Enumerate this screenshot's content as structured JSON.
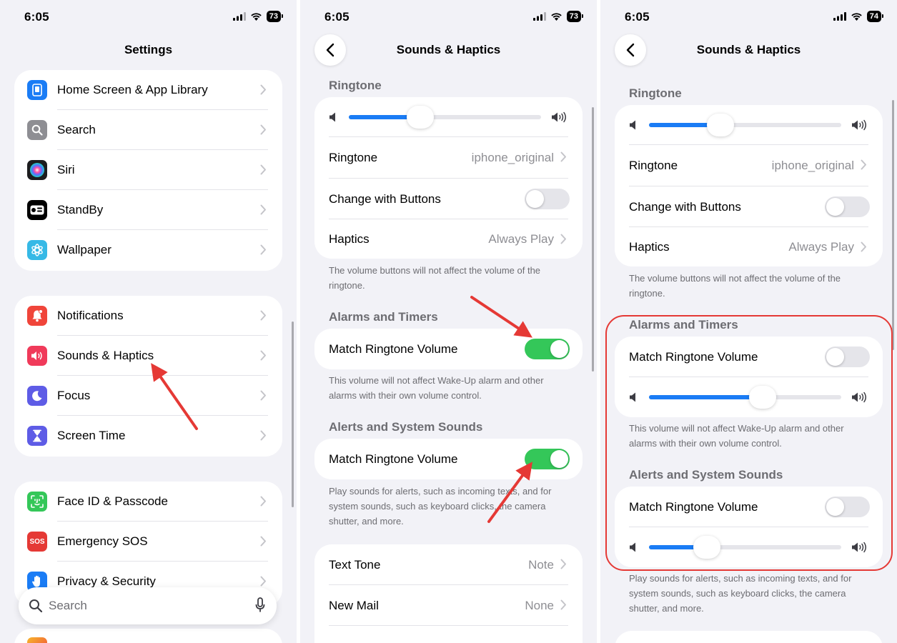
{
  "status": {
    "time_1": "6:05",
    "time_2": "6:05",
    "time_3": "6:05",
    "battery_1": "73",
    "battery_2": "73",
    "battery_3": "74"
  },
  "settings": {
    "title": "Settings",
    "group1": [
      {
        "label": "Home Screen & App Library",
        "icon": "home-screen-icon",
        "color": "#1a7cf5"
      },
      {
        "label": "Search",
        "icon": "search-icon",
        "color": "#8e8e93"
      },
      {
        "label": "Siri",
        "icon": "siri-icon",
        "color": "#1c1c1e"
      },
      {
        "label": "StandBy",
        "icon": "standby-icon",
        "color": "#000000"
      },
      {
        "label": "Wallpaper",
        "icon": "wallpaper-icon",
        "color": "#36b9e6"
      }
    ],
    "group2": [
      {
        "label": "Notifications",
        "icon": "bell-icon",
        "color": "#f0453a"
      },
      {
        "label": "Sounds & Haptics",
        "icon": "speaker-icon",
        "color": "#f03a5a"
      },
      {
        "label": "Focus",
        "icon": "moon-icon",
        "color": "#5e5ce6"
      },
      {
        "label": "Screen Time",
        "icon": "hourglass-icon",
        "color": "#5e5ce6"
      }
    ],
    "group3": [
      {
        "label": "Face ID & Passcode",
        "icon": "faceid-icon",
        "color": "#34c759"
      },
      {
        "label": "Emergency SOS",
        "icon": "sos-icon",
        "color": "#e53935",
        "badge": "SOS"
      },
      {
        "label": "Privacy & Security",
        "icon": "hand-icon",
        "color": "#1a7cf5"
      }
    ],
    "search_placeholder": "Search"
  },
  "sounds": {
    "title": "Sounds & Haptics",
    "ringtone_header": "Ringtone",
    "ringtone_label": "Ringtone",
    "ringtone_value": "iphone_original",
    "change_with_buttons": "Change with Buttons",
    "haptics_label": "Haptics",
    "haptics_value": "Always Play",
    "ringtone_footer": "The volume buttons will not affect the volume of the ringtone.",
    "alarms_header": "Alarms and Timers",
    "match_label": "Match Ringtone Volume",
    "alarms_footer": "This volume will not affect Wake-Up alarm and other alarms with their own volume control.",
    "alerts_header": "Alerts and System Sounds",
    "alerts_footer": "Play sounds for alerts, such as incoming texts, and for system sounds, such as keyboard clicks, the camera shutter, and more.",
    "text_tone_label": "Text Tone",
    "text_tone_value": "Note",
    "new_mail_label": "New Mail",
    "new_mail_value": "None"
  },
  "state": {
    "ringtone_volume": 0.37,
    "panel2": {
      "change_with_buttons": false,
      "alarms_match": true,
      "alerts_match": true
    },
    "panel3": {
      "change_with_buttons": false,
      "alarms_match": false,
      "alerts_match": false,
      "alarms_volume": 0.59,
      "alerts_volume": 0.3
    }
  },
  "colors": {
    "toggle_on": "#34c759",
    "slider_fill": "#1a7cf5",
    "annotation": "#e53935"
  }
}
